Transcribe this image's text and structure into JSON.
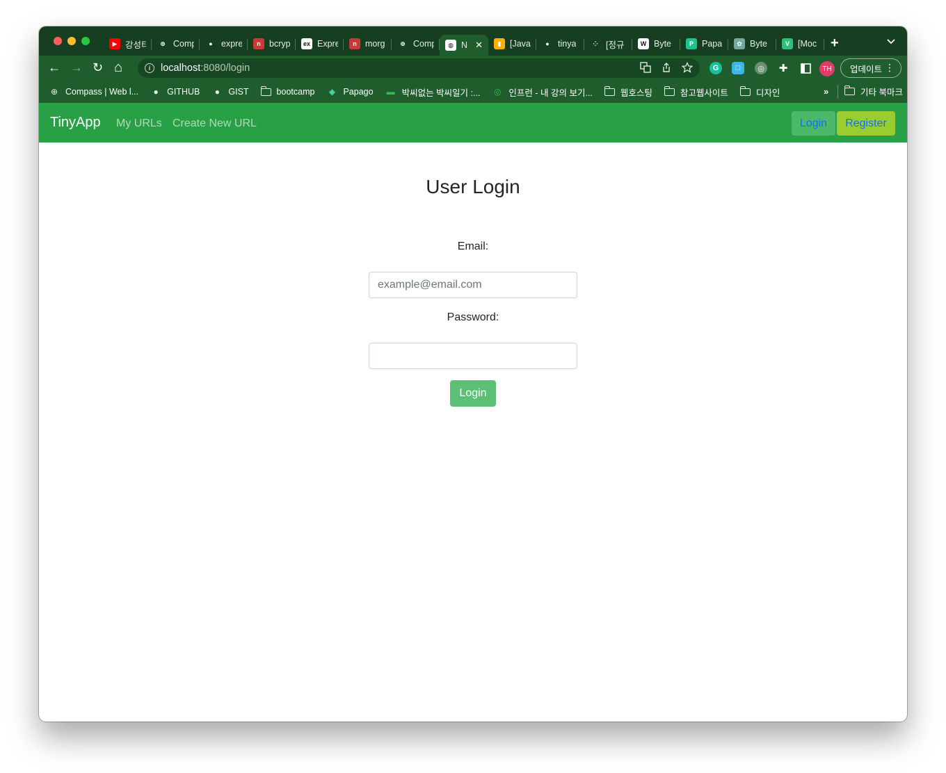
{
  "browser": {
    "tabs": [
      {
        "title": "강성티",
        "icon": "youtube-icon",
        "color": "#ff0000"
      },
      {
        "title": "Comp",
        "icon": "compass-icon",
        "color": "#163f22"
      },
      {
        "title": "expre",
        "icon": "github-icon",
        "color": "#163f22"
      },
      {
        "title": "bcryp",
        "icon": "npm-icon",
        "color": "#cb3837"
      },
      {
        "title": "Expre",
        "icon": "express-icon",
        "color": "#ffffff"
      },
      {
        "title": "morg",
        "icon": "npm-icon",
        "color": "#cb3837"
      },
      {
        "title": "Comp",
        "icon": "compass-icon",
        "color": "#163f22"
      },
      {
        "title": "N",
        "icon": "globe-icon",
        "color": "#ffffff",
        "active": true
      },
      {
        "title": "[Java",
        "icon": "chart-icon",
        "color": "#ffb000"
      },
      {
        "title": "tinya",
        "icon": "github-icon",
        "color": "#163f22"
      },
      {
        "title": "[정규",
        "icon": "dots-icon",
        "color": "#163f22"
      },
      {
        "title": "Byte",
        "icon": "wikipedia-icon",
        "color": "#ffffff"
      },
      {
        "title": "Papa",
        "icon": "papago-icon",
        "color": "#1ec38b"
      },
      {
        "title": "Byte",
        "icon": "openai-icon",
        "color": "#74aa9c"
      },
      {
        "title": "[Moc",
        "icon": "v-icon",
        "color": "#2ec17a"
      }
    ],
    "tab_close": "✕",
    "new_tab": "+",
    "tab_menu": "⌄",
    "nav": {
      "back": "←",
      "forward": "→",
      "reload": "↻",
      "home": "⌂"
    },
    "address": {
      "host": "localhost",
      "path": ":8080/login"
    },
    "omnibox_icons": [
      "translate-icon",
      "share-icon",
      "star-icon"
    ],
    "extensions": [
      {
        "name": "grammarly-icon",
        "color": "#15c39a",
        "glyph": "G"
      },
      {
        "name": "extension-blue-icon",
        "color": "#3ab6e8",
        "glyph": "□"
      },
      {
        "name": "extension-globe-icon",
        "color": "#6b8f73",
        "glyph": "◎"
      }
    ],
    "profile_initials": "TH",
    "update_label": "업데이트",
    "bookmarks": [
      {
        "label": "Compass | Web l...",
        "icon": "compass-icon"
      },
      {
        "label": "GITHUB",
        "icon": "github-icon"
      },
      {
        "label": "GIST",
        "icon": "github-icon"
      },
      {
        "label": "bootcamp",
        "icon": "folder-icon"
      },
      {
        "label": "Papago",
        "icon": "papago-icon"
      },
      {
        "label": "박씨없는 박씨일기 :...",
        "icon": "blog-icon"
      },
      {
        "label": "인프런 - 내 강의 보기...",
        "icon": "inflearn-icon"
      },
      {
        "label": "웹호스팅",
        "icon": "folder-icon"
      },
      {
        "label": "참고웹사이트",
        "icon": "folder-icon"
      },
      {
        "label": "디자인",
        "icon": "folder-icon"
      }
    ],
    "bookmarks_more": "»",
    "other_bookmarks": "기타 북마크"
  },
  "app": {
    "brand": "TinyApp",
    "nav_links": [
      "My URLs",
      "Create New URL"
    ],
    "login_button": "Login",
    "register_button": "Register",
    "colors": {
      "navbar": "#28a045",
      "login_bg": "#4cb96a",
      "register_bg": "#9acd32",
      "link": "#0d6efd",
      "submit_bg": "#5bbf76"
    }
  },
  "form": {
    "title": "User Login",
    "email_label": "Email:",
    "email_placeholder": "example@email.com",
    "email_value": "",
    "password_label": "Password:",
    "password_value": "",
    "submit_label": "Login"
  }
}
